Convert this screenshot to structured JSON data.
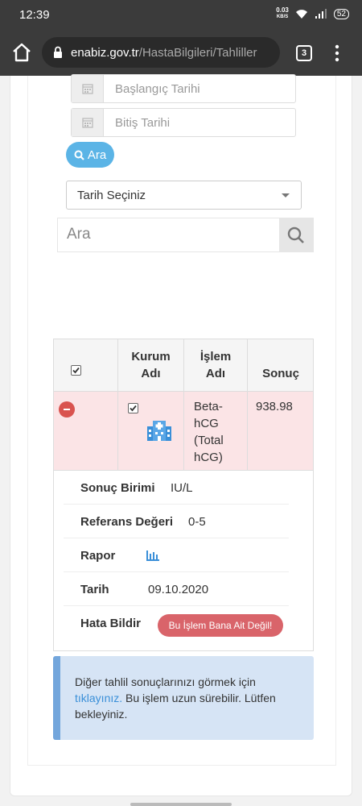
{
  "status_bar": {
    "time": "12:39",
    "net_speed": "0.03",
    "net_unit": "KB/S",
    "battery": "52"
  },
  "browser": {
    "url_domain": "enabiz.gov.tr",
    "url_path": "/HastaBilgileri/Tahliller",
    "tab_count": "3"
  },
  "filters": {
    "start_date_placeholder": "Başlangıç Tarihi",
    "end_date_placeholder": "Bitiş Tarihi",
    "search_button_label": "Ara",
    "date_select_value": "Tarih Seçiniz",
    "search_placeholder": "Ara"
  },
  "table": {
    "headers": {
      "institution_line1": "Kurum",
      "institution_line2": "Adı",
      "process_line1": "İşlem",
      "process_line2": "Adı",
      "result": "Sonuç"
    },
    "rows": [
      {
        "process_lines": [
          "Beta-",
          "hCG",
          "(Total",
          "hCG)"
        ],
        "result": "938.98",
        "checked": true
      }
    ],
    "details": {
      "unit_label": "Sonuç Birimi",
      "unit_value": "IU/L",
      "reference_label": "Referans Değeri",
      "reference_value": "0-5",
      "report_label": "Rapor",
      "date_label": "Tarih",
      "date_value": "09.10.2020",
      "error_label": "Hata Bildir",
      "error_button": "Bu İşlem Bana Ait Değil!"
    }
  },
  "info_box": {
    "text_before": "Diğer tahlil sonuçlarınızı görmek için ",
    "link_text": "tıklayınız.",
    "text_after": " Bu işlem uzun sürebilir. Lütfen bekleyiniz."
  }
}
